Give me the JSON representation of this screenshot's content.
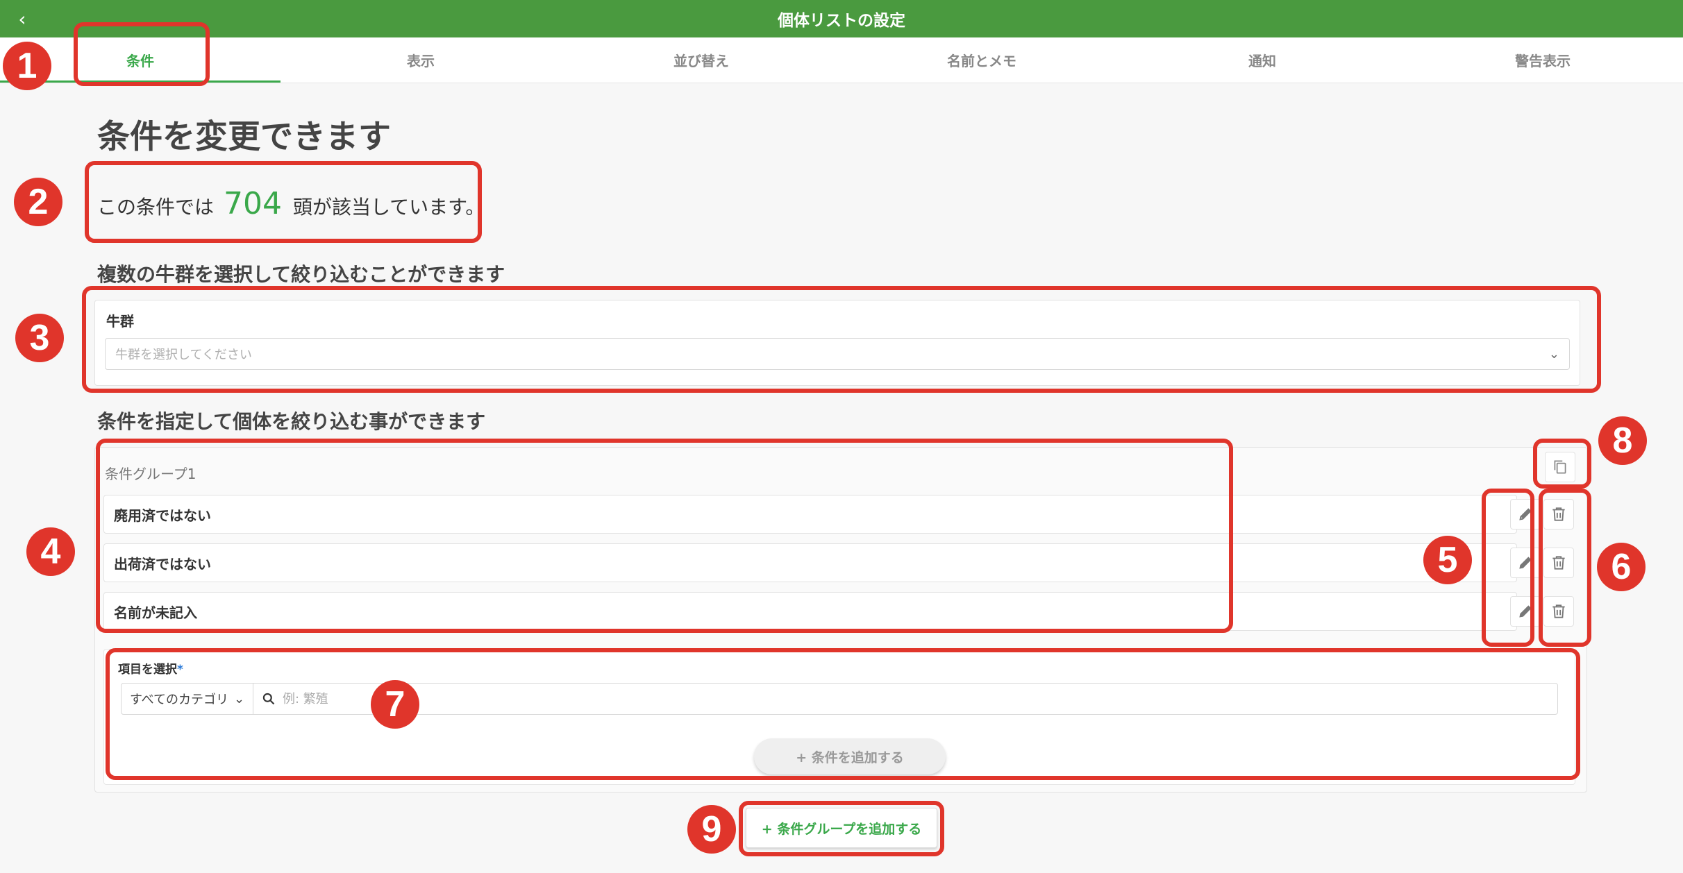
{
  "header": {
    "title": "個体リストの設定",
    "back_icon": "chevron-left-icon"
  },
  "tabs": [
    {
      "label": "条件",
      "active": true
    },
    {
      "label": "表示",
      "active": false
    },
    {
      "label": "並び替え",
      "active": false
    },
    {
      "label": "名前とメモ",
      "active": false
    },
    {
      "label": "通知",
      "active": false
    },
    {
      "label": "警告表示",
      "active": false
    }
  ],
  "main": {
    "headline": "条件を変更できます",
    "match_prefix": "この条件では",
    "match_count": "704",
    "match_suffix": "頭が該当しています。",
    "herd_section_title": "複数の牛群を選択して絞り込むことができます",
    "herd_label": "牛群",
    "herd_placeholder": "牛群を選択してください",
    "cond_section_title": "条件を指定して個体を絞り込む事ができます"
  },
  "condition_group": {
    "label": "条件グループ1",
    "conditions": [
      {
        "label": "廃用済ではない"
      },
      {
        "label": "出荷済ではない"
      },
      {
        "label": "名前が未記入"
      }
    ]
  },
  "add_item": {
    "label": "項目を選択",
    "required_mark": "*",
    "category": "すべてのカテゴリ",
    "search_placeholder": "例: 繁殖",
    "add_condition_label": "+ 条件を追加する"
  },
  "add_group_label": "+ 条件グループを追加する",
  "annotations": [
    "1",
    "2",
    "3",
    "4",
    "5",
    "6",
    "7",
    "8",
    "9"
  ],
  "colors": {
    "header": "#4a9a3f",
    "accent": "#3aa84a",
    "annotation": "#e0352b"
  }
}
